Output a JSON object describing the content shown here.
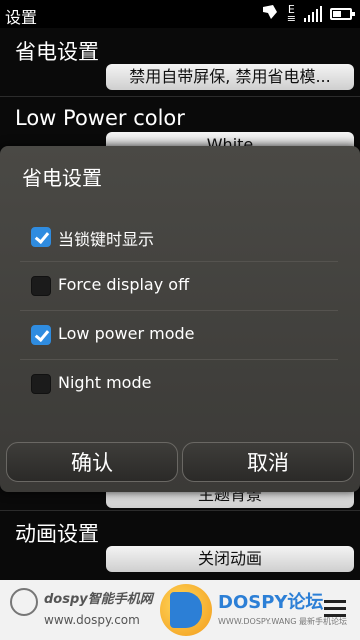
{
  "status_bar": {
    "title": "设置",
    "network_label": "E",
    "battery_level": 0.5
  },
  "settings": {
    "power_saving": {
      "title": "省电设置",
      "value": "禁用自带屏保, 禁用省电模..."
    },
    "low_power_color": {
      "title": "Low Power color",
      "value": "White"
    },
    "theme_background": {
      "value": "主题背景"
    },
    "animation": {
      "title": "动画设置",
      "value": "关闭动画"
    }
  },
  "dialog": {
    "title": "省电设置",
    "items": [
      {
        "label": "当锁键时显示",
        "checked": true
      },
      {
        "label": "Force display off",
        "checked": false
      },
      {
        "label": "Low power mode",
        "checked": true
      },
      {
        "label": "Night mode",
        "checked": false
      }
    ],
    "confirm_label": "确认",
    "cancel_label": "取消"
  },
  "watermark": {
    "brand": "dospy智能手机网",
    "url": "www.dospy.com",
    "right_brand": "DOSPY论坛",
    "right_sub": "WWW.DOSPY.WANG 最新手机论坛"
  },
  "colors": {
    "accent": "#2f8ce0",
    "dialog_bg": "#434240"
  }
}
